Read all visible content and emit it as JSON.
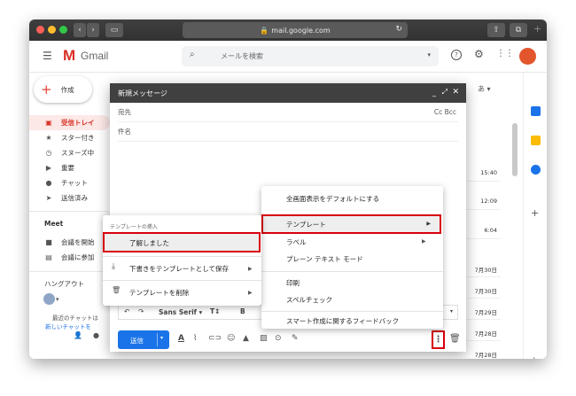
{
  "browser": {
    "url": "mail.google.com"
  },
  "gmail": {
    "logo_text": "Gmail",
    "search_placeholder": "メールを検索",
    "compose_button": "作成",
    "language_button": "あ ▾"
  },
  "sidebar": {
    "items": [
      {
        "label": "受信トレイ"
      },
      {
        "label": "スター付き"
      },
      {
        "label": "スヌーズ中"
      },
      {
        "label": "重要"
      },
      {
        "label": "チャット"
      },
      {
        "label": "送信済み"
      }
    ],
    "meet_heading": "Meet",
    "meet_items": [
      {
        "label": "会議を開始"
      },
      {
        "label": "会議に参加"
      }
    ],
    "hangouts_heading": "ハングアウト",
    "hangouts_text1": "最近のチャットは",
    "hangouts_text2": "新しいチャットを"
  },
  "mail_dates": [
    "15:40",
    "12:09",
    "6:04",
    "7月30日",
    "7月30日",
    "7月29日",
    "7月28日",
    "7月28日"
  ],
  "compose": {
    "title": "新規メッセージ",
    "to_label": "宛先",
    "cc_bcc": "Cc Bcc",
    "subject_label": "件名",
    "send_label": "送信",
    "font_name": "Sans Serif"
  },
  "more_menu": {
    "items": [
      "全画面表示をデフォルトにする",
      "テンプレート",
      "ラベル",
      "プレーン テキスト モード",
      "印刷",
      "スペルチェック",
      "スマート作成に関するフィードバック"
    ]
  },
  "template_menu": {
    "heading": "テンプレートの挿入",
    "item_insert": "了解しました",
    "item_save": "下書きをテンプレートとして保存",
    "item_delete": "テンプレートを削除"
  },
  "colors": {
    "titlebar": "#3a3a3a",
    "compose_header": "#404040",
    "send_button": "#1a73e8",
    "highlight_box": "#d8000c",
    "inbox_red": "#d93025"
  }
}
